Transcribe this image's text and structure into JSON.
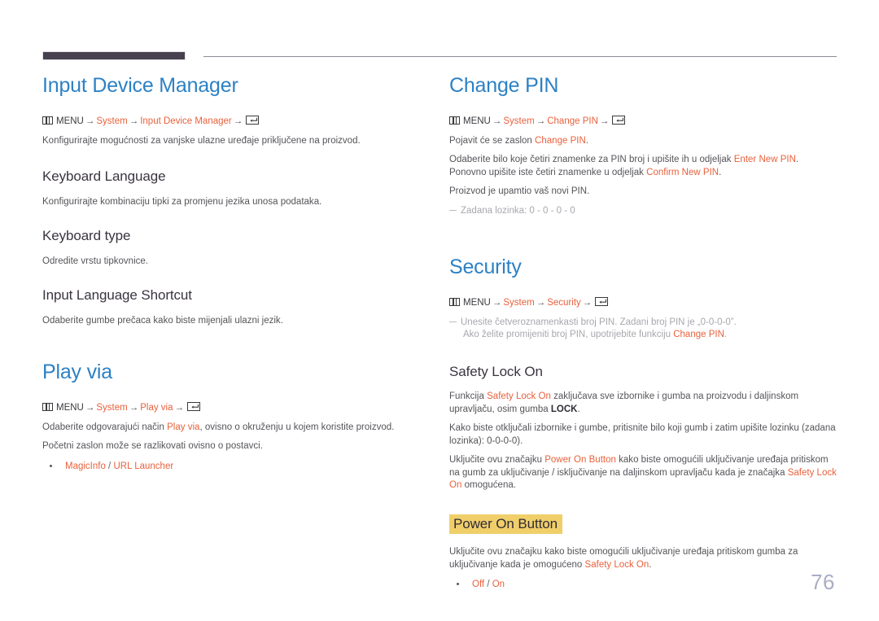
{
  "document": {
    "page_number": "76",
    "accent_blue": "#2d81c4",
    "accent_orange": "#e8613c",
    "highlight_yellow": "#f0cf6a",
    "header_bar_color": "#46404f"
  },
  "icons": {
    "menu": "menu-icon",
    "enter": "enter-key-icon"
  },
  "left_column": {
    "sections": [
      {
        "title": "Input Device Manager",
        "path": {
          "menu_label": "MENU",
          "arrow": "→",
          "steps": [
            "System",
            "Input Device Manager"
          ]
        },
        "paragraphs": [
          "Konfigurirajte mogućnosti za vanjske ulazne uređaje priključene na proizvod."
        ],
        "subsections": [
          {
            "title": "Keyboard Language",
            "paragraphs": [
              "Konfigurirajte kombinaciju tipki za promjenu jezika unosa podataka."
            ]
          },
          {
            "title": "Keyboard type",
            "paragraphs": [
              "Odredite vrstu tipkovnice."
            ]
          },
          {
            "title": "Input Language Shortcut",
            "paragraphs": [
              "Odaberite gumbe prečaca kako biste mijenjali ulazni jezik."
            ]
          }
        ]
      },
      {
        "title": "Play via",
        "path": {
          "menu_label": "MENU",
          "arrow": "→",
          "steps": [
            "System",
            "Play via"
          ]
        },
        "paragraph_1_pre": "Odaberite odgovarajući način ",
        "paragraph_1_term": "Play via",
        "paragraph_1_post": ", ovisno o okruženju u kojem koristite proizvod.",
        "paragraph_2": "Početni zaslon može se razlikovati ovisno o postavci.",
        "bullets": [
          {
            "option_a": "MagicInfo",
            "separator": " / ",
            "option_b": "URL Launcher"
          }
        ]
      }
    ]
  },
  "right_column": {
    "sections": [
      {
        "title": "Change PIN",
        "path": {
          "menu_label": "MENU",
          "arrow": "→",
          "steps": [
            "System",
            "Change PIN"
          ]
        },
        "paragraph_1_pre": "Pojavit će se zaslon ",
        "paragraph_1_term": "Change PIN",
        "paragraph_1_post": ".",
        "paragraph_2_pre": "Odaberite bilo koje četiri znamenke za PIN broj i upišite ih u odjeljak ",
        "paragraph_2_term1": "Enter New PIN",
        "paragraph_2_mid": ". Ponovno upišite iste četiri znamenke u odjeljak ",
        "paragraph_2_term2": "Confirm New PIN",
        "paragraph_2_post": ".",
        "paragraph_3": "Proizvod je upamtio vaš novi PIN.",
        "note": "Zadana lozinka: 0 - 0 - 0 - 0"
      },
      {
        "title": "Security",
        "path": {
          "menu_label": "MENU",
          "arrow": "→",
          "steps": [
            "System",
            "Security"
          ]
        },
        "note_line_1": "Unesite četveroznamenkasti broj PIN. Zadani broj PIN je „0-0-0-0”.",
        "note_line_2_pre": "Ako želite promijeniti broj PIN, upotrijebite funkciju ",
        "note_line_2_term": "Change PIN",
        "note_line_2_post": ".",
        "subsections": [
          {
            "title": "Safety Lock On",
            "p1_pre": "Funkcija ",
            "p1_term": "Safety Lock On",
            "p1_mid": " zaključava sve izbornike i gumba na proizvodu i daljinskom upravljaču, osim gumba ",
            "p1_bold": "LOCK",
            "p1_post": ".",
            "p2": "Kako biste otključali izbornike i gumbe, pritisnite bilo koji gumb i zatim upišite lozinku (zadana lozinka): 0-0-0-0).",
            "p3_pre": "Uključite ovu značajku ",
            "p3_term1": "Power On Button",
            "p3_mid": " kako biste omogućili uključivanje uređaja pritiskom na gumb za uključivanje / isključivanje na daljinskom upravljaču kada je značajka ",
            "p3_term2": "Safety Lock On",
            "p3_post": " omogućena."
          },
          {
            "title": "Power On Button",
            "highlighted": true,
            "p1_pre": "Uključite ovu značajku kako biste omogućili uključivanje uređaja pritiskom gumba za uključivanje kada je omogućeno ",
            "p1_term": "Safety Lock On",
            "p1_post": ".",
            "bullets": [
              {
                "option_a": "Off",
                "separator": " / ",
                "option_b": "On"
              }
            ]
          }
        ]
      }
    ]
  }
}
